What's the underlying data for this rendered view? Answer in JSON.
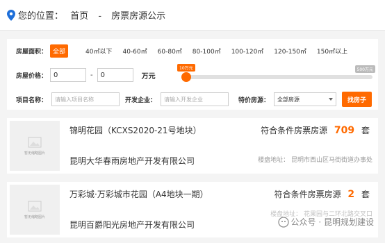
{
  "breadcrumb": {
    "location_label": "您的位置：",
    "home": "首页",
    "separator": "-",
    "current": "房票房源公示"
  },
  "filter": {
    "area_label": "房屋面积：",
    "area_options": [
      "全部",
      "40㎡以下",
      "40-60㎡",
      "60-80㎡",
      "80-100㎡",
      "100-120㎡",
      "120-150㎡",
      "150㎡以上"
    ],
    "price_label": "房屋价格：",
    "price_min": "0",
    "price_max": "0",
    "price_dash": "-",
    "price_unit": "万元",
    "slider_min_label": "10万元",
    "slider_max_label": "500万元",
    "project_label": "项目名称：",
    "project_placeholder": "请输入项目名称",
    "developer_label": "开发企业：",
    "developer_placeholder": "请输入开发企业",
    "special_label": "特价房源：",
    "special_value": "全部房源",
    "search_button": "找房子"
  },
  "listings": [
    {
      "no_image": "暂无缩略图片",
      "name": "锦明花园（KCXS2020-21号地块）",
      "developer": "昆明大华春雨房地产开发有限公司",
      "count_prefix": "符合条件房票房源",
      "count": "709",
      "count_suffix": "套",
      "address": "楼盘地址：  昆明市西山区马街街道办事处"
    },
    {
      "no_image": "暂无缩略图片",
      "name": "万彩城·万彩城市花园（A4地块一期）",
      "developer": "昆明百爵阳光房地产开发有限公司",
      "count_prefix": "符合条件房票房源",
      "count": "2",
      "count_suffix": "套",
      "address": "楼盘地址：  花果园与二环北路交叉口"
    }
  ],
  "watermark": "公众号 · 昆明规划建设",
  "colors": {
    "accent": "#ff6a00",
    "pin": "#1e6fd9"
  }
}
